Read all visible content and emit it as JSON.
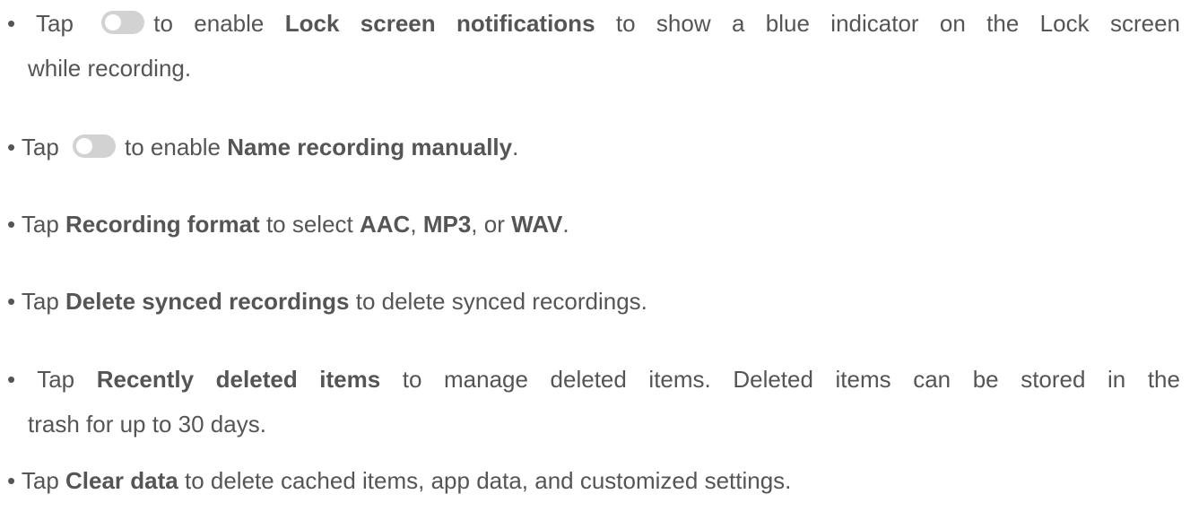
{
  "bullet": "• ",
  "items": [
    {
      "tap": "Tap",
      "after_toggle": "to enable",
      "bold": "Lock screen notifications",
      "rest": "to show a blue indicator on the Lock screen",
      "continuation": "while recording."
    },
    {
      "tap": "Tap",
      "after_toggle": "to enable",
      "bold": "Name recording manually",
      "end": "."
    },
    {
      "tap": "Tap",
      "bold": "Recording format",
      "mid": "to select",
      "opt1": "AAC",
      "sep1": ",",
      "opt2": "MP3",
      "sep2": ", or",
      "opt3": "WAV",
      "end": "."
    },
    {
      "tap": "Tap",
      "bold": "Delete synced recordings",
      "rest": "to delete synced recordings."
    },
    {
      "tap": "Tap",
      "bold": "Recently deleted items",
      "rest": "to manage deleted items. Deleted items can be stored in the",
      "continuation": "trash for up to 30 days."
    },
    {
      "tap": "Tap",
      "bold": "Clear data",
      "rest": "to delete cached items, app data, and customized settings."
    }
  ]
}
